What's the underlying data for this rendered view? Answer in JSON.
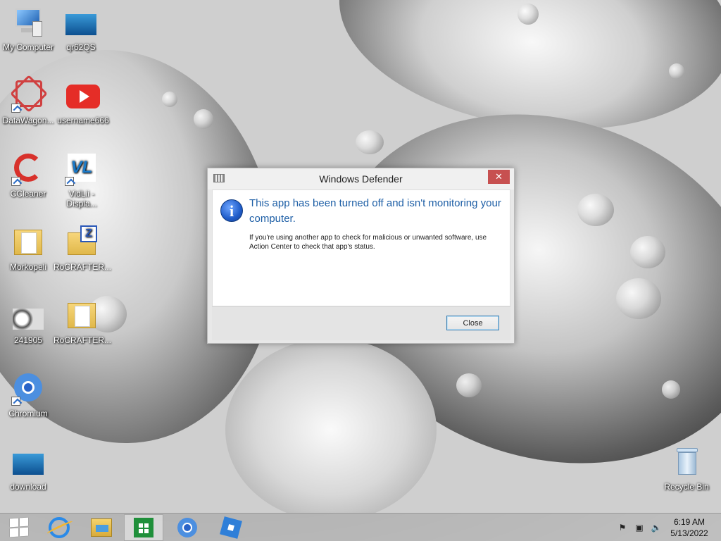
{
  "desktop_icons": [
    {
      "id": "my-computer",
      "label": "My Computer"
    },
    {
      "id": "qr62qs",
      "label": "qr62QS"
    },
    {
      "id": "datawagon",
      "label": "DataWagon..."
    },
    {
      "id": "username666",
      "label": "username666"
    },
    {
      "id": "ccleaner",
      "label": "CCleaner"
    },
    {
      "id": "vidlii",
      "label": "VidLii - Displa..."
    },
    {
      "id": "morkopeli",
      "label": "Morkopeli"
    },
    {
      "id": "rocrafter-zip",
      "label": "RoCRAFTER..."
    },
    {
      "id": "241905",
      "label": "241905"
    },
    {
      "id": "rocrafter-folder",
      "label": "RoCRAFTER..."
    },
    {
      "id": "chromium",
      "label": "Chromium"
    },
    {
      "id": "download",
      "label": "download"
    },
    {
      "id": "recycle-bin",
      "label": "Recycle Bin"
    }
  ],
  "dialog": {
    "title": "Windows Defender",
    "close_glyph": "✕",
    "info_glyph": "i",
    "main_instruction": "This app has been turned off and isn't monitoring your computer.",
    "supplemental": "If you're using another app to check for malicious or unwanted software, use Action Center to check that app's status.",
    "close_button": "Close"
  },
  "taskbar": {
    "buttons": [
      {
        "name": "start-icon"
      },
      {
        "name": "internet-explorer-icon"
      },
      {
        "name": "file-explorer-icon"
      },
      {
        "name": "store-icon",
        "active": true
      },
      {
        "name": "chromium-icon"
      },
      {
        "name": "roblox-icon"
      }
    ],
    "tray": {
      "flag_icon": "action-center-flag-icon",
      "network_icon": "network-icon",
      "volume_icon": "volume-muted-icon"
    },
    "clock": {
      "time": "6:19 AM",
      "date": "5/13/2022"
    }
  },
  "colors": {
    "dialog_title_close": "#c75050",
    "main_instruction": "#1e5fa6",
    "youtube_red": "#e52d27",
    "store_green": "#1f8f3a"
  }
}
